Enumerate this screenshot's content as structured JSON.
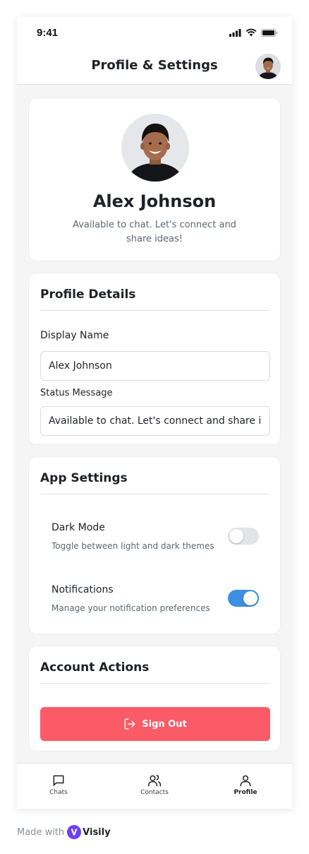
{
  "status_bar": {
    "time": "9:41"
  },
  "header": {
    "title": "Profile & Settings"
  },
  "profile": {
    "name": "Alex Johnson",
    "status": "Available to chat. Let's connect and share ideas!"
  },
  "details": {
    "title": "Profile Details",
    "display_name_label": "Display Name",
    "display_name_value": "Alex Johnson",
    "status_label": "Status Message",
    "status_value": "Available to chat. Let's connect and share ideas!"
  },
  "settings": {
    "title": "App Settings",
    "dark_mode": {
      "label": "Dark Mode",
      "description": "Toggle between light and dark themes",
      "enabled": false
    },
    "notifications": {
      "label": "Notifications",
      "description": "Manage your notification preferences",
      "enabled": true
    }
  },
  "account": {
    "title": "Account Actions",
    "sign_out_label": "Sign Out"
  },
  "nav": {
    "items": [
      {
        "label": "Chats",
        "icon": "chat-bubble-icon",
        "active": false
      },
      {
        "label": "Contacts",
        "icon": "users-icon",
        "active": false
      },
      {
        "label": "Profile",
        "icon": "user-icon",
        "active": true
      }
    ]
  },
  "footer": {
    "made_with": "Made with",
    "brand": "Visily"
  },
  "colors": {
    "accent_blue": "#3d8fe0",
    "danger": "#fb5b67",
    "brand_purple": "#6f3ff5"
  }
}
